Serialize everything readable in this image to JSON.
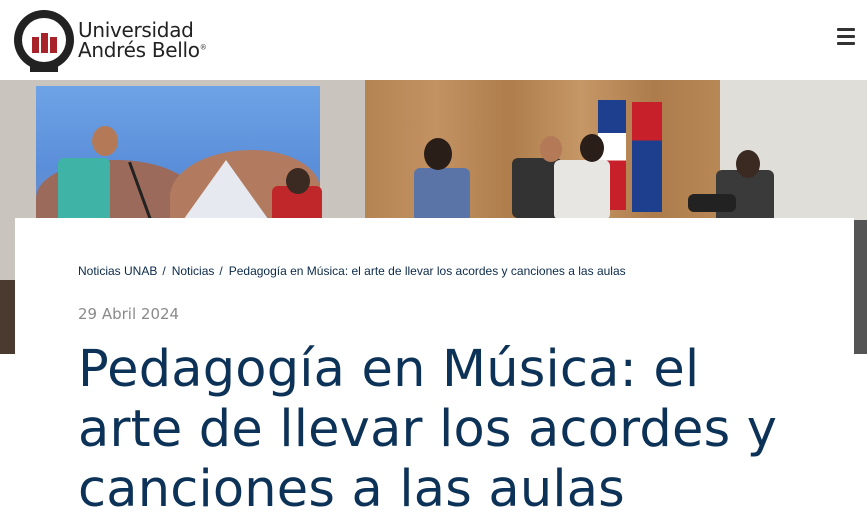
{
  "header": {
    "logo_line1": "Universidad",
    "logo_line2": "Andrés Bello",
    "logo_reg": "®",
    "menu_icon": "hamburger-icon"
  },
  "hero": {
    "image_alt": ""
  },
  "breadcrumb": {
    "items": [
      {
        "label": "Noticias UNAB"
      },
      {
        "label": "Noticias"
      },
      {
        "label": "Pedagogía en Música: el arte de llevar los acordes y canciones a las aulas"
      }
    ],
    "separator": "/"
  },
  "article": {
    "date": "29 Abril 2024",
    "title": "Pedagogía en Música: el arte de llevar los acordes y canciones a las aulas"
  },
  "colors": {
    "brand_red": "#a8222a",
    "title_blue": "#0d3258",
    "date_gray": "#8a8a8a"
  }
}
